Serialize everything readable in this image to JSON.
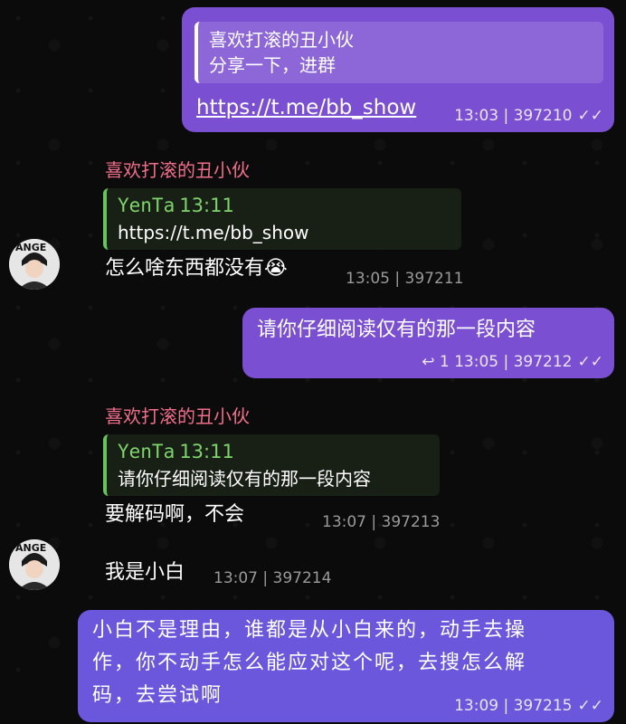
{
  "messages": {
    "m1": {
      "quote_name": "喜欢打滚的丑小伙",
      "quote_text": "分享一下，进群",
      "link": "https://t.me/bb_show",
      "meta": "13:03 | 397210"
    },
    "m2": {
      "sender": "喜欢打滚的丑小伙",
      "quote_name": "YenTa",
      "quote_time": "13:11",
      "quote_text": "https://t.me/bb_show",
      "text": "怎么啥东西都没有😭",
      "meta": "13:05 | 397211"
    },
    "m3": {
      "text": "请你仔细阅读仅有的那一段内容",
      "reply_count": "1",
      "meta": "13:05 | 397212"
    },
    "m4": {
      "sender": "喜欢打滚的丑小伙",
      "quote_name": "YenTa",
      "quote_time": "13:11",
      "quote_text": "请你仔细阅读仅有的那一段内容",
      "text": "要解码啊，不会",
      "meta": "13:07 | 397213"
    },
    "m5": {
      "text": "我是小白",
      "meta": "13:07 | 397214"
    },
    "m6": {
      "text_line1": "小白不是理由，谁都是从小白来的，动手去操",
      "text_line2": "作，你不动手怎么能应对这个呢，去搜怎么解",
      "text_line3": "码，去尝试啊",
      "meta": "13:09 | 397215"
    }
  },
  "avatar_text": "ANGE",
  "colors": {
    "out": "#7b4fd1",
    "sender": "#ef6f8b",
    "quote_green": "#67c35b"
  }
}
